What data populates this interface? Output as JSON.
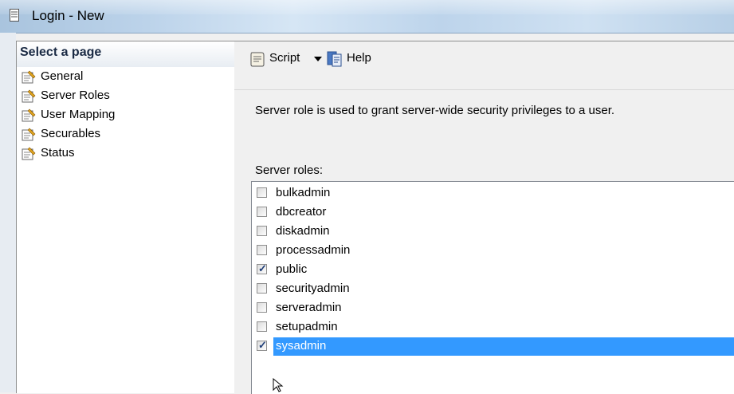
{
  "window": {
    "title": "Login - New",
    "icon": "document-icon"
  },
  "left_pane": {
    "header": "Select a page",
    "items": [
      {
        "label": "General",
        "icon": "page-settings-icon"
      },
      {
        "label": "Server Roles",
        "icon": "page-settings-icon"
      },
      {
        "label": "User Mapping",
        "icon": "page-settings-icon"
      },
      {
        "label": "Securables",
        "icon": "page-settings-icon"
      },
      {
        "label": "Status",
        "icon": "page-settings-icon"
      }
    ]
  },
  "toolbar": {
    "script_label": "Script",
    "help_label": "Help"
  },
  "content": {
    "description": "Server role is used to grant server-wide security privileges to a user.",
    "roles_label": "Server roles:",
    "roles": [
      {
        "name": "bulkadmin",
        "checked": false,
        "selected": false
      },
      {
        "name": "dbcreator",
        "checked": false,
        "selected": false
      },
      {
        "name": "diskadmin",
        "checked": false,
        "selected": false
      },
      {
        "name": "processadmin",
        "checked": false,
        "selected": false
      },
      {
        "name": "public",
        "checked": true,
        "selected": false
      },
      {
        "name": "securityadmin",
        "checked": false,
        "selected": false
      },
      {
        "name": "serveradmin",
        "checked": false,
        "selected": false
      },
      {
        "name": "setupadmin",
        "checked": false,
        "selected": false
      },
      {
        "name": "sysadmin",
        "checked": true,
        "selected": true
      }
    ]
  },
  "colors": {
    "selection": "#3399ff",
    "check": "#1f3e78"
  }
}
